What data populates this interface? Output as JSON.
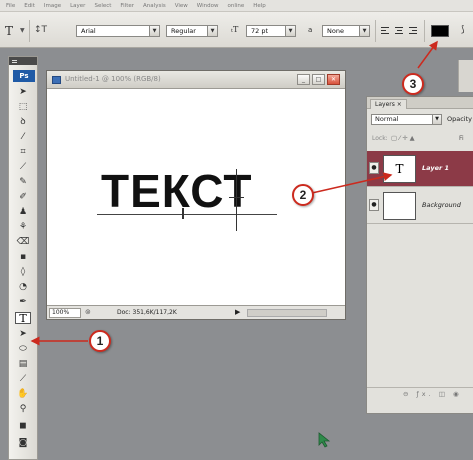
{
  "menubar": {
    "items": [
      "File",
      "Edit",
      "Image",
      "Layer",
      "Select",
      "Filter",
      "Analysis",
      "View",
      "Window",
      "online",
      "Help"
    ]
  },
  "options_bar": {
    "tool_icon": "T",
    "font_family": "Arial",
    "font_style": "Regular",
    "font_size": "72 pt",
    "aa_label": "a",
    "antialias": "None",
    "text_color": "#000000"
  },
  "toolbox": {
    "logo": "Ps",
    "selected_tool": "T"
  },
  "document": {
    "title": "Untitled-1 @ 100% (RGB/8)",
    "text": "ТЕКСТ",
    "zoom": "100%",
    "doc_info": "Doc: 351,6K/117,2K"
  },
  "layers_panel": {
    "tab": "Layers",
    "blend_mode": "Normal",
    "opacity_label": "Opacity",
    "lock_label": "Lock:",
    "fill_label": "Fi",
    "layers": [
      {
        "thumb": "T",
        "name": "Layer 1"
      },
      {
        "thumb": "",
        "name": "Background"
      }
    ]
  },
  "callouts": {
    "one": "1",
    "two": "2",
    "three": "3",
    "color": "#cc2a1e"
  }
}
